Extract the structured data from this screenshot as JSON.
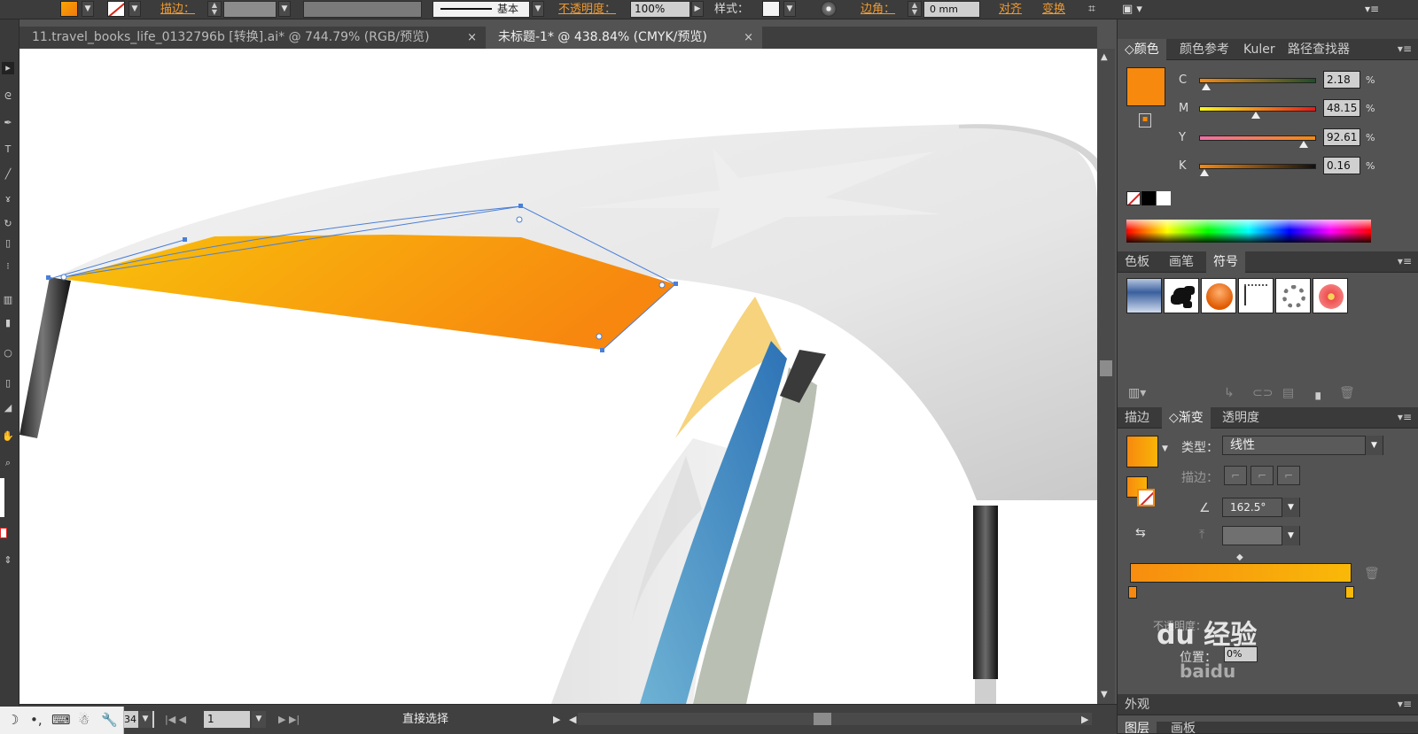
{
  "control_bar": {
    "stroke_label": "描边：",
    "stroke_style": "基本",
    "opacity_label": "不透明度：",
    "opacity_value": "100%",
    "style_label": "样式：",
    "corner_label": "边角：",
    "corner_value": "0 mm",
    "align_label": "对齐",
    "transform_label": "变换"
  },
  "document_tabs": [
    {
      "title": "11.travel_books_life_0132796b [转换].ai* @ 744.79% (RGB/预览)",
      "close": "×"
    },
    {
      "title": "未标题-1* @ 438.84% (CMYK/预览)",
      "close": "×"
    }
  ],
  "status_bar": {
    "zoom": "34",
    "page": "1",
    "current_tool": "直接选择"
  },
  "color_panel": {
    "tabs": [
      "颜色",
      "颜色参考",
      "Kuler",
      "路径查找器"
    ],
    "fill_color": "#f7890f",
    "channels": [
      {
        "label": "C",
        "value": "2.18",
        "unit": "%",
        "fraction": 0.02
      },
      {
        "label": "M",
        "value": "48.15",
        "unit": "%",
        "fraction": 0.48
      },
      {
        "label": "Y",
        "value": "92.61",
        "unit": "%",
        "fraction": 0.93
      },
      {
        "label": "K",
        "value": "0.16",
        "unit": "%",
        "fraction": 0.0
      }
    ]
  },
  "swatch_panel": {
    "tabs": [
      "色板",
      "画笔",
      "符号"
    ]
  },
  "gradient_panel": {
    "tabs": [
      "描边",
      "渐变",
      "透明度"
    ],
    "type_label": "类型：",
    "type_value": "线性",
    "stroke_label": "描边：",
    "angle_value": "162.5°",
    "opacity_label": "不透明度：",
    "position_label": "位置：",
    "position_value": "0%",
    "start_color": "#f7890f",
    "end_color": "#f9b908"
  },
  "bottom_panels": {
    "appearance_label": "外观",
    "layers_tabs": [
      "图层",
      "画板"
    ]
  },
  "watermark": {
    "text": "du 经验",
    "sub": "baidu"
  }
}
